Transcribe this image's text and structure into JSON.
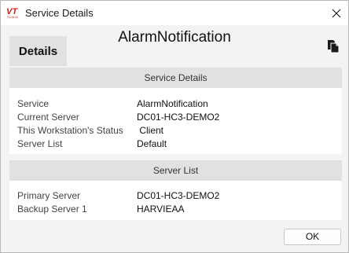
{
  "window": {
    "title": "Service Details",
    "logo_text": "VT",
    "logo_subtext": "SCADA"
  },
  "header": {
    "service_name": "AlarmNotification"
  },
  "tabs": [
    {
      "label": "Details",
      "selected": true
    }
  ],
  "service_details": {
    "heading": "Service Details",
    "rows": [
      {
        "label": "Service",
        "value": "AlarmNotification"
      },
      {
        "label": "Current Server",
        "value": "DC01-HC3-DEMO2"
      },
      {
        "label": "This Workstation's Status",
        "value": " Client"
      },
      {
        "label": "Server List",
        "value": "Default"
      }
    ]
  },
  "server_list": {
    "heading": "Server List",
    "rows": [
      {
        "label": "Primary Server",
        "value": "DC01-HC3-DEMO2"
      },
      {
        "label": "Backup Server 1",
        "value": "HARVIEAA"
      }
    ]
  },
  "buttons": {
    "ok_label": "OK"
  },
  "colors": {
    "logo_red": "#d0241c",
    "header_band": "#e1e1e1",
    "background": "#f3f3f3"
  },
  "icons": {
    "close": "close-icon",
    "copy": "copy-icon",
    "logo": "vtscada-logo"
  }
}
